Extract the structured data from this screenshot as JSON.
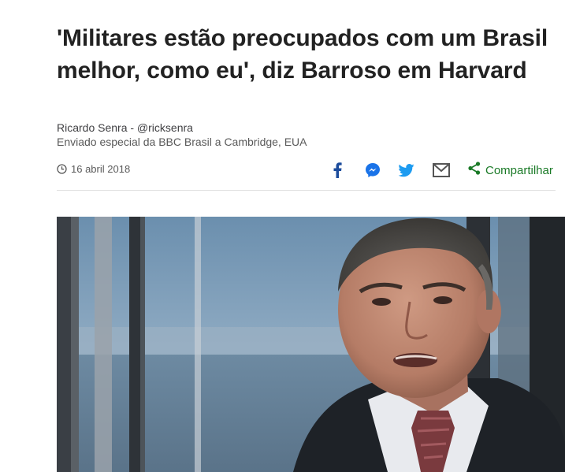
{
  "article": {
    "headline": "'Militares estão preocupados com um Brasil melhor, como eu', diz Barroso em Harvard",
    "author": "Ricardo Senra - @ricksenra",
    "author_role": "Enviado especial da BBC Brasil a Cambridge, EUA",
    "date": "16 abril 2018"
  },
  "share": {
    "icons": [
      "facebook-icon",
      "messenger-icon",
      "twitter-icon",
      "email-icon"
    ],
    "share_label": "Compartilhar"
  },
  "colors": {
    "headline": "#222222",
    "share_green": "#1a7a27",
    "facebook": "#1c4c9c",
    "messenger": "#1a73e8",
    "twitter": "#1d9bf0",
    "email": "#555555"
  }
}
